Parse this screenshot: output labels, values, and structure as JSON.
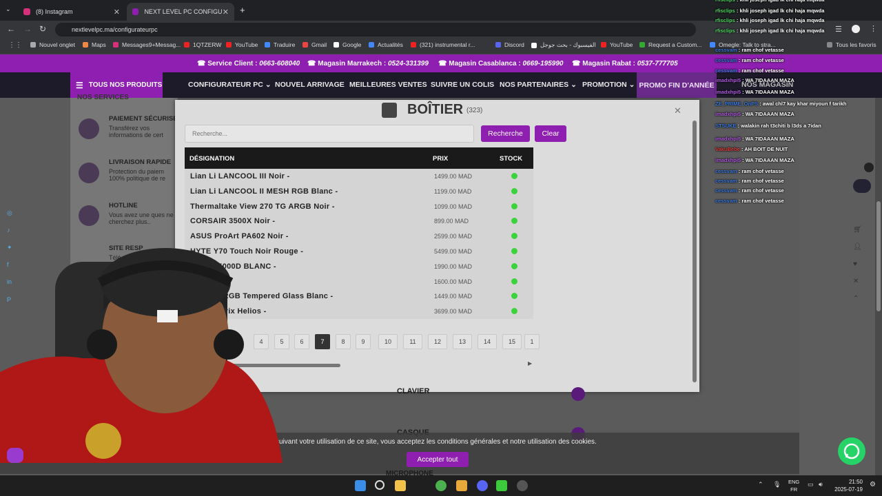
{
  "browser": {
    "tabs": [
      {
        "title": "(8) Instagram"
      },
      {
        "title": "NEXT LEVEL PC CONFIGURATEUR"
      }
    ],
    "url": "nextlevelpc.ma/configurateurpc",
    "bookmarks": [
      "Nouvel onglet",
      "Maps",
      "Messages9+Messag...",
      "1QTZERW",
      "YouTube",
      "Traduire",
      "Gmail",
      "Google",
      "Actualités",
      "(321) instrumental r...",
      "Discord",
      "الفيسبوك - بحث جوجل",
      "YouTube",
      "Request a Custom...",
      "Omegle: Talk to stra..."
    ],
    "all_bookmarks": "Tous les favoris"
  },
  "site": {
    "info": [
      {
        "label": "Service Client :",
        "value": "0663-608040"
      },
      {
        "label": "Magasin Marrakech :",
        "value": "0524-331399"
      },
      {
        "label": "Magasin Casablanca :",
        "value": "0669-195990"
      },
      {
        "label": "Magasin Rabat :",
        "value": "0537-777705"
      }
    ],
    "all_products": "TOUS NOS PRODUITS",
    "nav": [
      "CONFIGURATEUR PC",
      "NOUVEL ARRIVAGE",
      "MEILLEURES VENTES",
      "SUIVRE UN COLIS",
      "NOS PARTENAIRES",
      "PROMOTION"
    ],
    "promo": "PROMO FIN D'ANNÉE",
    "stores": "NOS MAGASIN",
    "services_heading": "NOS SERVICES",
    "features": [
      {
        "title": "PAIEMENT SÉCURISÉ",
        "text": "Transférez vos informations de cert"
      },
      {
        "title": "LIVRAISON RAPIDE",
        "text": "Protection du paiem 100% politique de re"
      },
      {
        "title": "HOTLINE",
        "text": "Vous avez une ques ne cherchez plus.."
      },
      {
        "title": "SITE RESP",
        "text": "Télé"
      }
    ],
    "accordion": [
      "CLAVIER",
      "CASQUE",
      "MICROPHONE"
    ],
    "cookie_text": "suivant votre utilisation de ce site, vous acceptez les conditions générales et notre utilisation des cookies.",
    "cookie_accept": "Accepter tout"
  },
  "modal": {
    "title": "BOÎTIER",
    "count": "(323)",
    "search_placeholder": "Recherche...",
    "search_button": "Recherche",
    "clear_button": "Clear",
    "columns": [
      "DÉSIGNATION",
      "PRIX",
      "STOCK"
    ],
    "rows": [
      {
        "name": "Lian Li LANCOOL III Noir -",
        "price": "1499.00 MAD"
      },
      {
        "name": "Lian Li LANCOOL II MESH RGB Blanc -",
        "price": "1199.00 MAD"
      },
      {
        "name": "Thermaltake View 270 TG ARGB Noir -",
        "price": "1099.00 MAD"
      },
      {
        "name": "CORSAIR 3500X Noir -",
        "price": "899.00 MAD"
      },
      {
        "name": "ASUS ProArt PA602 Noir -",
        "price": "2599.00 MAD"
      },
      {
        "name": "HYTE Y70 Touch Noir Rouge -",
        "price": "5499.00 MAD"
      },
      {
        "name": "Boitier 5000D BLANC -",
        "price": "1990.00 MAD"
      },
      {
        "name": "ER X8 -",
        "price": "1600.00 MAD"
      },
      {
        "name": "E 4000X RGB Tempered Glass Blanc -",
        "price": "1449.00 MAD"
      },
      {
        "name": "1 ROG Strix Helios -",
        "price": "3699.00 MAD"
      }
    ],
    "pages": [
      "4",
      "5",
      "6",
      "7",
      "8",
      "9",
      "10",
      "11",
      "12",
      "13",
      "14",
      "15",
      "1"
    ],
    "active_page": "7"
  },
  "chat": [
    {
      "user": "rfisclips",
      "msg": "khli joseph igad lk chi haja mqwda",
      "color": "#4cd964"
    },
    {
      "user": "rfisclips",
      "msg": "khli joseph igad lk chi haja mqwda",
      "color": "#4cd964"
    },
    {
      "user": "rfisclips",
      "msg": "khli joseph igad lk chi haja mqwda",
      "color": "#4cd964"
    },
    {
      "user": "rfisclips",
      "msg": "khli joseph igad lk chi haja mqwda",
      "color": "#4cd964"
    },
    {
      "user": "cessvam",
      "msg": "ram chof vetasse",
      "color": "#3b7be0"
    },
    {
      "user": "cessvam",
      "msg": "ram chof vetasse",
      "color": "#3b7be0"
    },
    {
      "user": "cessvam",
      "msg": "ram chof vetasse",
      "color": "#3b7be0"
    },
    {
      "user": "imadxhpi5",
      "msg": "WA 7IDAAAN MAZA",
      "color": "#b05ae0"
    },
    {
      "user": "imadxhpi5",
      "msg": "WA 7IDAAAN MAZA",
      "color": "#b05ae0"
    },
    {
      "user": "ZE_PRIME_OnPS",
      "msg": "awal chl7 kay khar miyoun f tarikh",
      "color": "#3b7be0"
    },
    {
      "user": "imadxhpi5",
      "msg": "WA 7IDAAAN MAZA",
      "color": "#b05ae0"
    },
    {
      "user": "STSUKE",
      "msg": "walakin rah t3chiti b l3ds a 7idan",
      "color": "#3b7be0"
    },
    {
      "user": "imadxhpi5",
      "msg": "WA 7IDAAAN MAZA",
      "color": "#b05ae0"
    },
    {
      "user": "VakuBebe",
      "msg": "AH BOIT DE NUIT",
      "color": "#e04040"
    },
    {
      "user": "imadxhpi5",
      "msg": "WA 7IDAAAN MAZA",
      "color": "#b05ae0"
    },
    {
      "user": "cessvam",
      "msg": "ram chof vetasse",
      "color": "#3b7be0"
    },
    {
      "user": "cessvam",
      "msg": "ram chof vetasse",
      "color": "#3b7be0"
    },
    {
      "user": "cessvam",
      "msg": "ram chof vetasse",
      "color": "#3b7be0"
    },
    {
      "user": "cessvam",
      "msg": "ram chof vetasse",
      "color": "#3b7be0"
    }
  ],
  "taskbar": {
    "lang": [
      "ENG",
      "FR"
    ],
    "time": "21:50",
    "date": "2025-07-19"
  }
}
